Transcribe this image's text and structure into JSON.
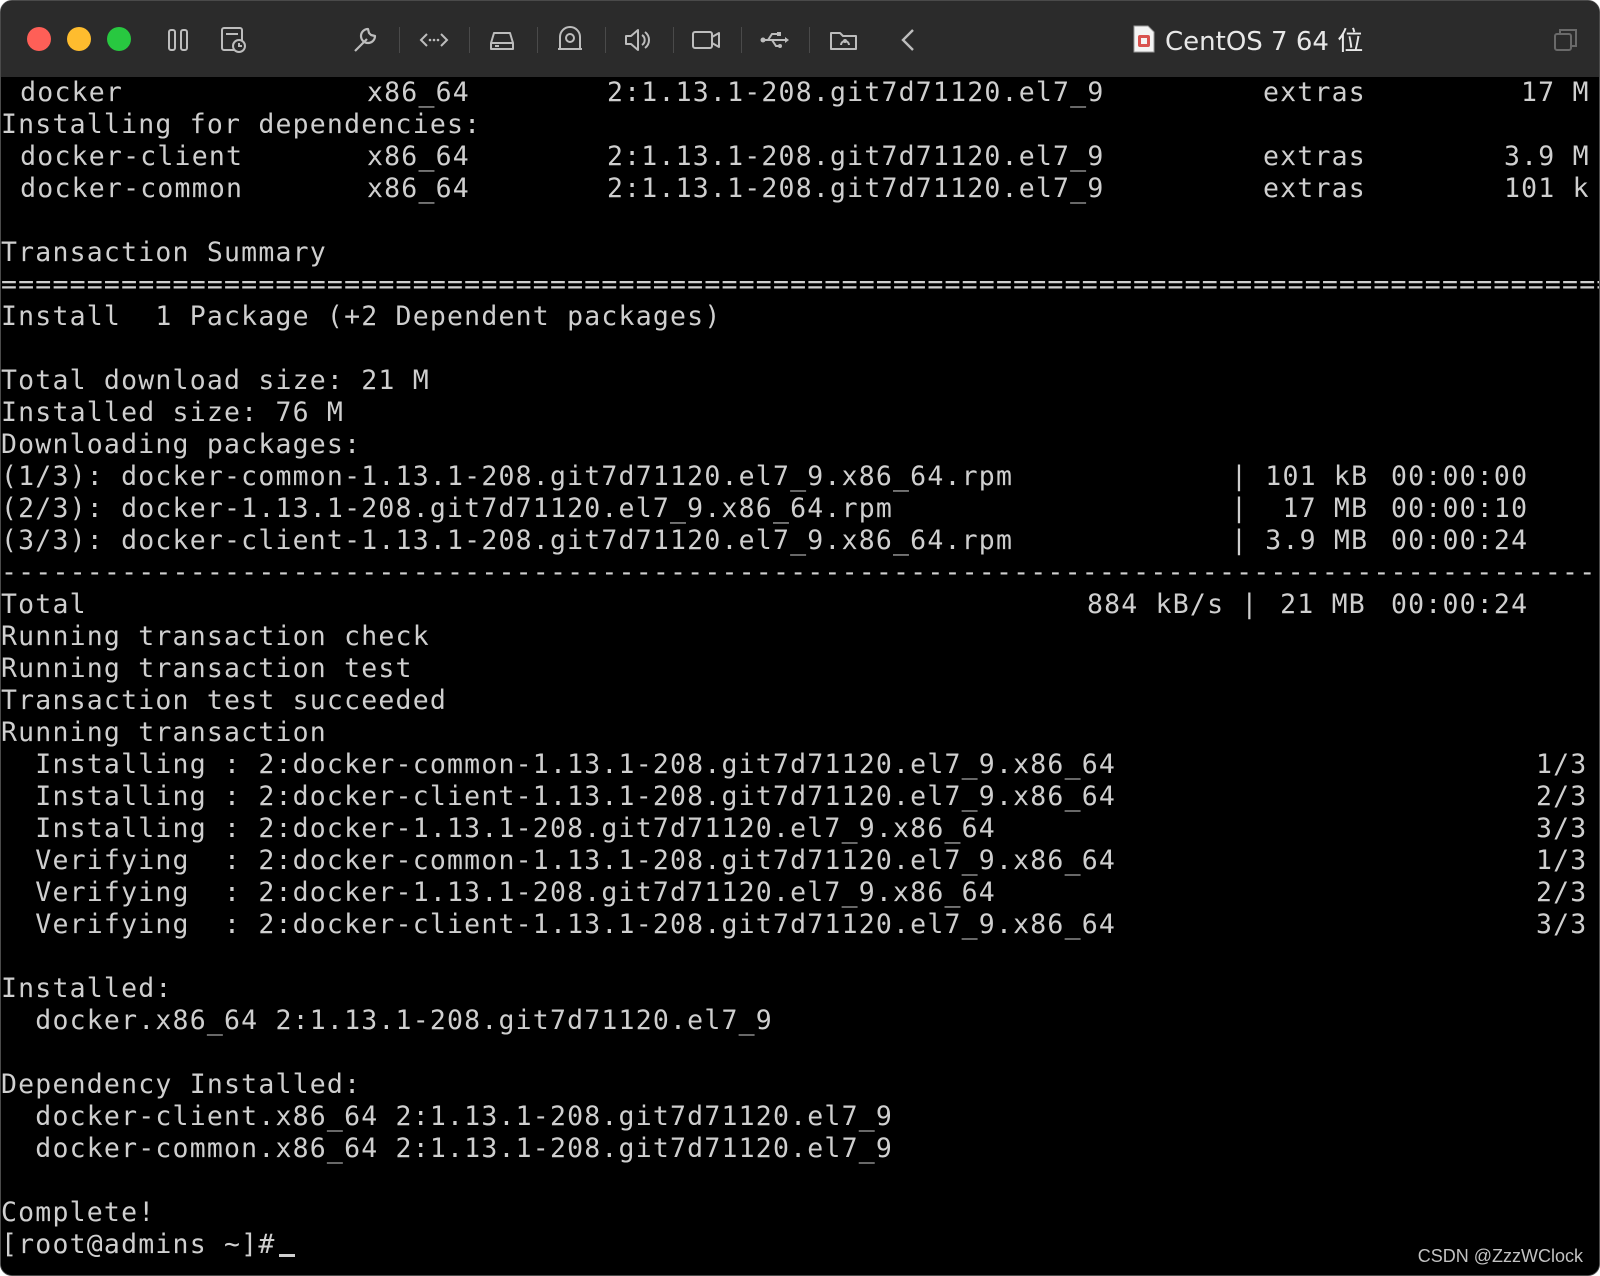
{
  "window": {
    "title": "CentOS 7 64 位"
  },
  "terminal": {
    "top_rows": [
      {
        "name": " docker",
        "arch": "x86_64",
        "version": "2:1.13.1-208.git7d71120.el7_9",
        "repo": "extras",
        "size": "17 M"
      }
    ],
    "deps_header": "Installing for dependencies:",
    "dep_rows": [
      {
        "name": " docker-client",
        "arch": "x86_64",
        "version": "2:1.13.1-208.git7d71120.el7_9",
        "repo": "extras",
        "size": "3.9 M"
      },
      {
        "name": " docker-common",
        "arch": "x86_64",
        "version": "2:1.13.1-208.git7d71120.el7_9",
        "repo": "extras",
        "size": "101 k"
      }
    ],
    "summary_title": "Transaction Summary",
    "install_line": "Install  1 Package (+2 Dependent packages)",
    "total_download": "Total download size: 21 M",
    "installed_size": "Installed size: 76 M",
    "downloading": "Downloading packages:",
    "downloads": [
      {
        "file": "(1/3): docker-common-1.13.1-208.git7d71120.el7_9.x86_64.rpm",
        "size": "| 101 kB",
        "time": "00:00:00"
      },
      {
        "file": "(2/3): docker-1.13.1-208.git7d71120.el7_9.x86_64.rpm",
        "size": "|  17 MB",
        "time": "00:00:10"
      },
      {
        "file": "(3/3): docker-client-1.13.1-208.git7d71120.el7_9.x86_64.rpm",
        "size": "| 3.9 MB",
        "time": "00:00:24"
      }
    ],
    "total_row": {
      "label": "Total",
      "rate": "884 kB/s |",
      "size": " 21 MB",
      "time": "00:00:24"
    },
    "status_lines": [
      "Running transaction check",
      "Running transaction test",
      "Transaction test succeeded",
      "Running transaction"
    ],
    "steps": [
      {
        "action": "  Installing : 2:docker-common-1.13.1-208.git7d71120.el7_9.x86_64",
        "count": "1/3"
      },
      {
        "action": "  Installing : 2:docker-client-1.13.1-208.git7d71120.el7_9.x86_64",
        "count": "2/3"
      },
      {
        "action": "  Installing : 2:docker-1.13.1-208.git7d71120.el7_9.x86_64",
        "count": "3/3"
      },
      {
        "action": "  Verifying  : 2:docker-common-1.13.1-208.git7d71120.el7_9.x86_64",
        "count": "1/3"
      },
      {
        "action": "  Verifying  : 2:docker-1.13.1-208.git7d71120.el7_9.x86_64",
        "count": "2/3"
      },
      {
        "action": "  Verifying  : 2:docker-client-1.13.1-208.git7d71120.el7_9.x86_64",
        "count": "3/3"
      }
    ],
    "installed_header": "Installed:",
    "installed_item": "  docker.x86_64 2:1.13.1-208.git7d71120.el7_9",
    "dep_installed_header": "Dependency Installed:",
    "dep_installed_items": [
      "  docker-client.x86_64 2:1.13.1-208.git7d71120.el7_9",
      "  docker-common.x86_64 2:1.13.1-208.git7d71120.el7_9"
    ],
    "complete": "Complete!",
    "prompt": "[root@admins ~]#"
  },
  "watermark": "CSDN @ZzzWClock"
}
